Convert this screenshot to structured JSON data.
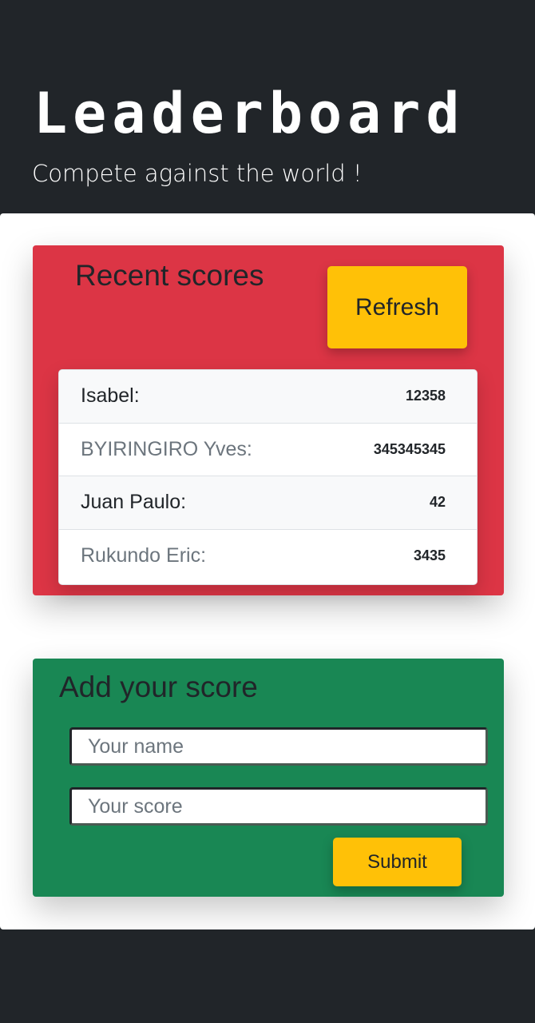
{
  "header": {
    "title": "Leaderboard",
    "subtitle": "Compete against the world !"
  },
  "recent_scores": {
    "title": "Recent scores",
    "refresh_label": "Refresh",
    "entries": [
      {
        "name": "Isabel:",
        "score": "12358"
      },
      {
        "name": "BYIRINGIRO Yves:",
        "score": "345345345"
      },
      {
        "name": "Juan Paulo:",
        "score": "42"
      },
      {
        "name": "Rukundo Eric:",
        "score": "3435"
      }
    ]
  },
  "add_score": {
    "title": "Add your score",
    "name_placeholder": "Your name",
    "score_placeholder": "Your score",
    "submit_label": "Submit"
  },
  "colors": {
    "background": "#212529",
    "scores_card": "#dc3545",
    "add_card": "#198754",
    "button": "#ffc107"
  }
}
